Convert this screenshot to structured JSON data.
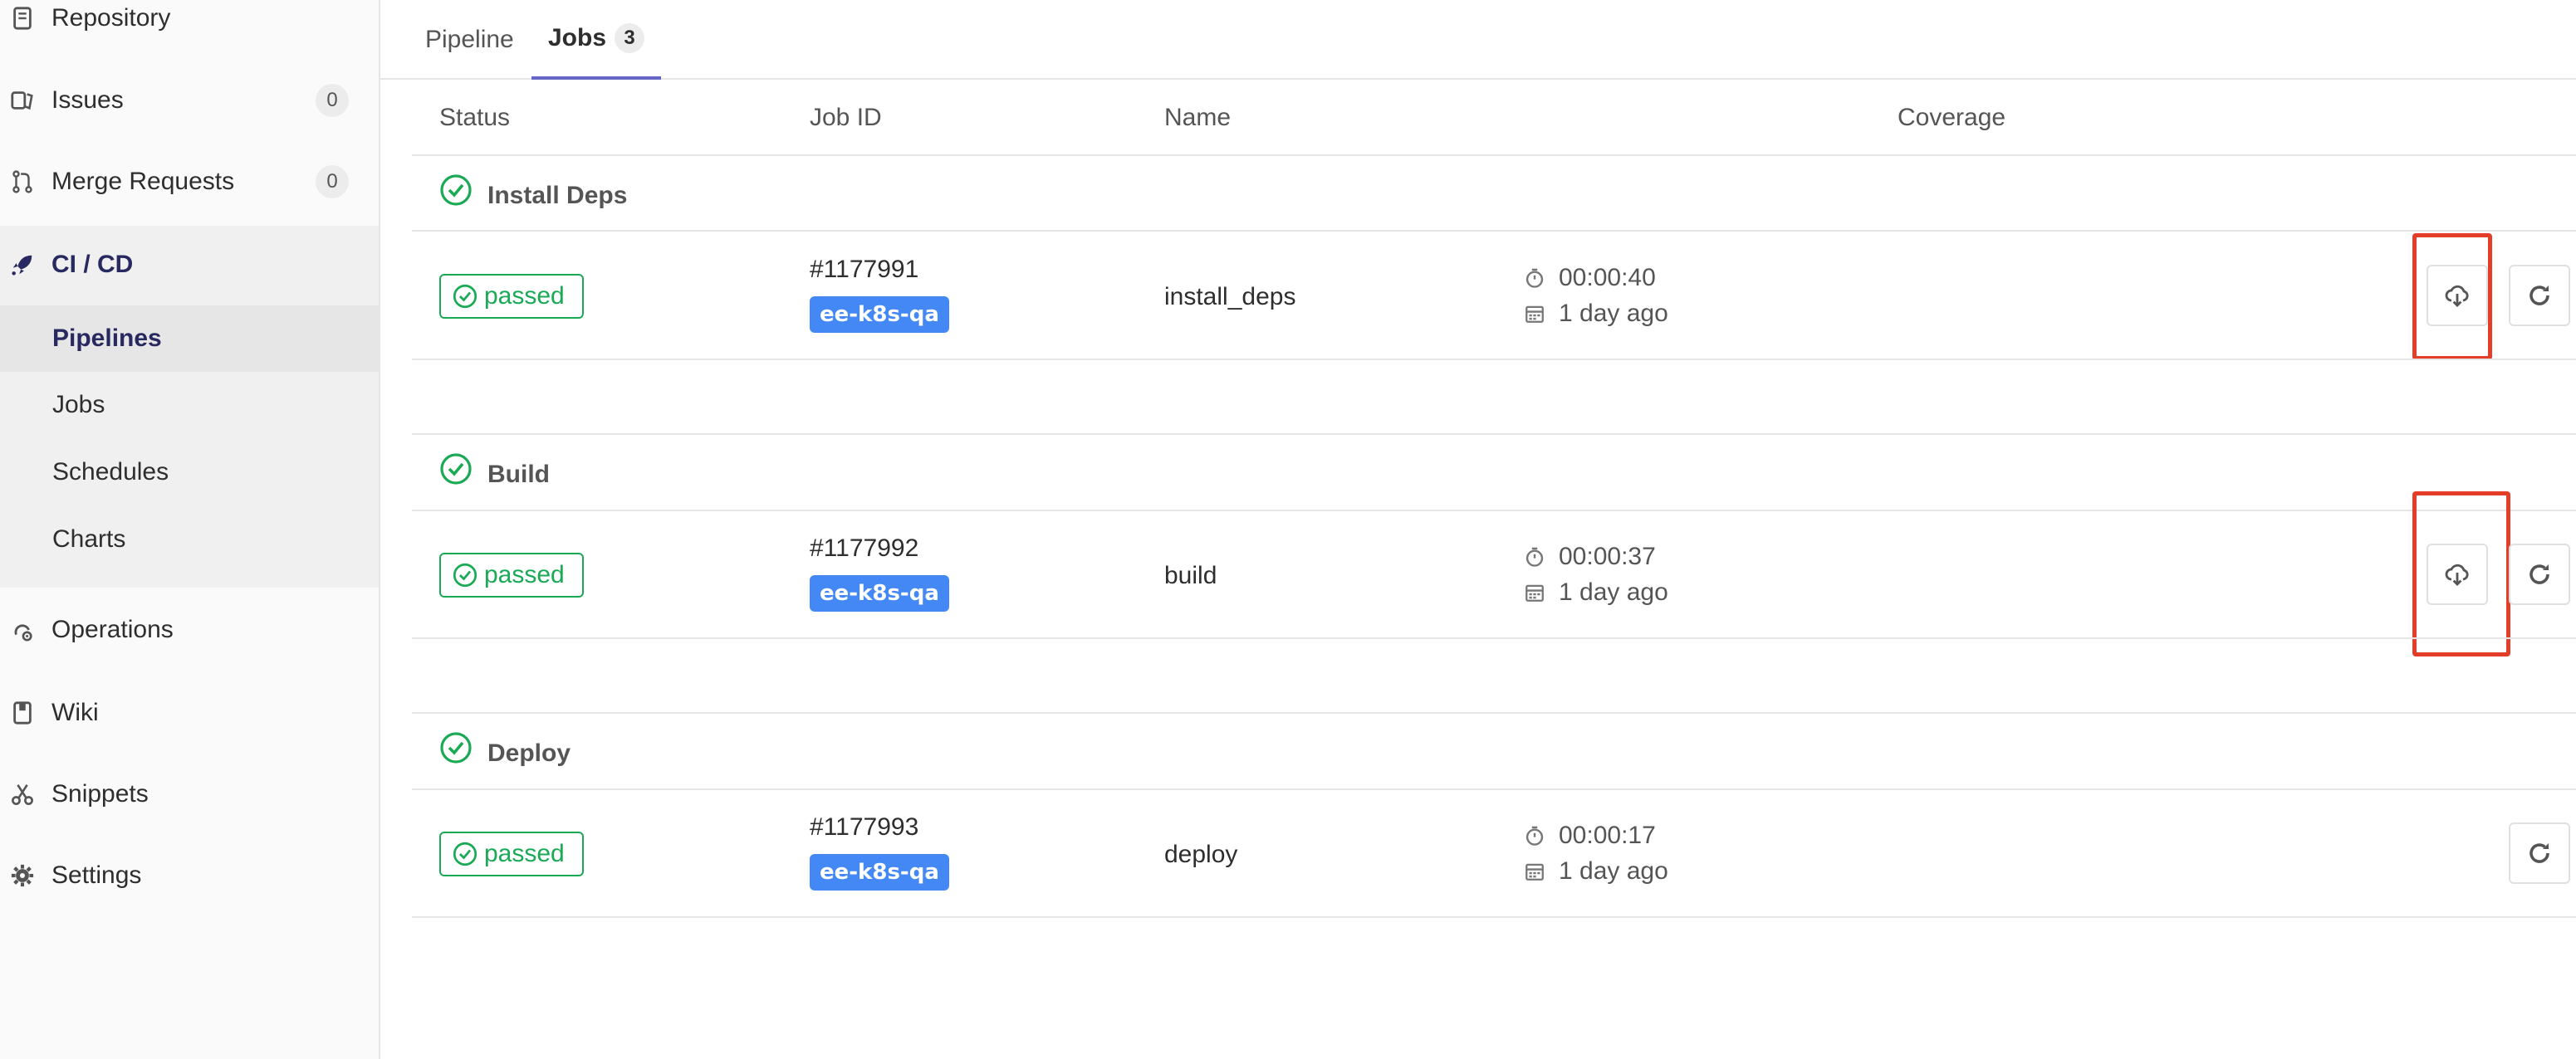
{
  "sidebar": {
    "items": [
      {
        "label": "Repository",
        "icon": "repository-icon"
      },
      {
        "label": "Issues",
        "icon": "issues-icon",
        "count": "0"
      },
      {
        "label": "Merge Requests",
        "icon": "merge-request-icon",
        "count": "0"
      },
      {
        "label": "CI / CD",
        "icon": "rocket-icon"
      },
      {
        "label": "Operations",
        "icon": "operations-icon"
      },
      {
        "label": "Wiki",
        "icon": "book-icon"
      },
      {
        "label": "Snippets",
        "icon": "scissors-icon"
      },
      {
        "label": "Settings",
        "icon": "gear-icon"
      }
    ],
    "cicd_subitems": [
      {
        "label": "Pipelines",
        "active": true
      },
      {
        "label": "Jobs"
      },
      {
        "label": "Schedules"
      },
      {
        "label": "Charts"
      }
    ]
  },
  "tabs": [
    {
      "label": "Pipeline"
    },
    {
      "label": "Jobs",
      "count": "3",
      "active": true
    }
  ],
  "table": {
    "headers": [
      "Status",
      "Job ID",
      "Name",
      "Coverage"
    ],
    "stages": [
      {
        "title": "Install Deps",
        "job": {
          "status": "passed",
          "id": "#1177991",
          "ref": "ee-k8s-qa",
          "name": "install_deps",
          "duration": "00:00:40",
          "finished": "1 day ago",
          "has_download": true
        }
      },
      {
        "title": "Build",
        "job": {
          "status": "passed",
          "id": "#1177992",
          "ref": "ee-k8s-qa",
          "name": "build",
          "duration": "00:00:37",
          "finished": "1 day ago",
          "has_download": true
        }
      },
      {
        "title": "Deploy",
        "job": {
          "status": "passed",
          "id": "#1177993",
          "ref": "ee-k8s-qa",
          "name": "deploy",
          "duration": "00:00:17",
          "finished": "1 day ago",
          "has_download": false
        }
      }
    ]
  },
  "colors": {
    "success": "#1aaa55",
    "ref_tag": "#4488f5",
    "highlight": "#e43d2a",
    "active_nav": "#292961",
    "tab_underline": "#6666c4"
  }
}
